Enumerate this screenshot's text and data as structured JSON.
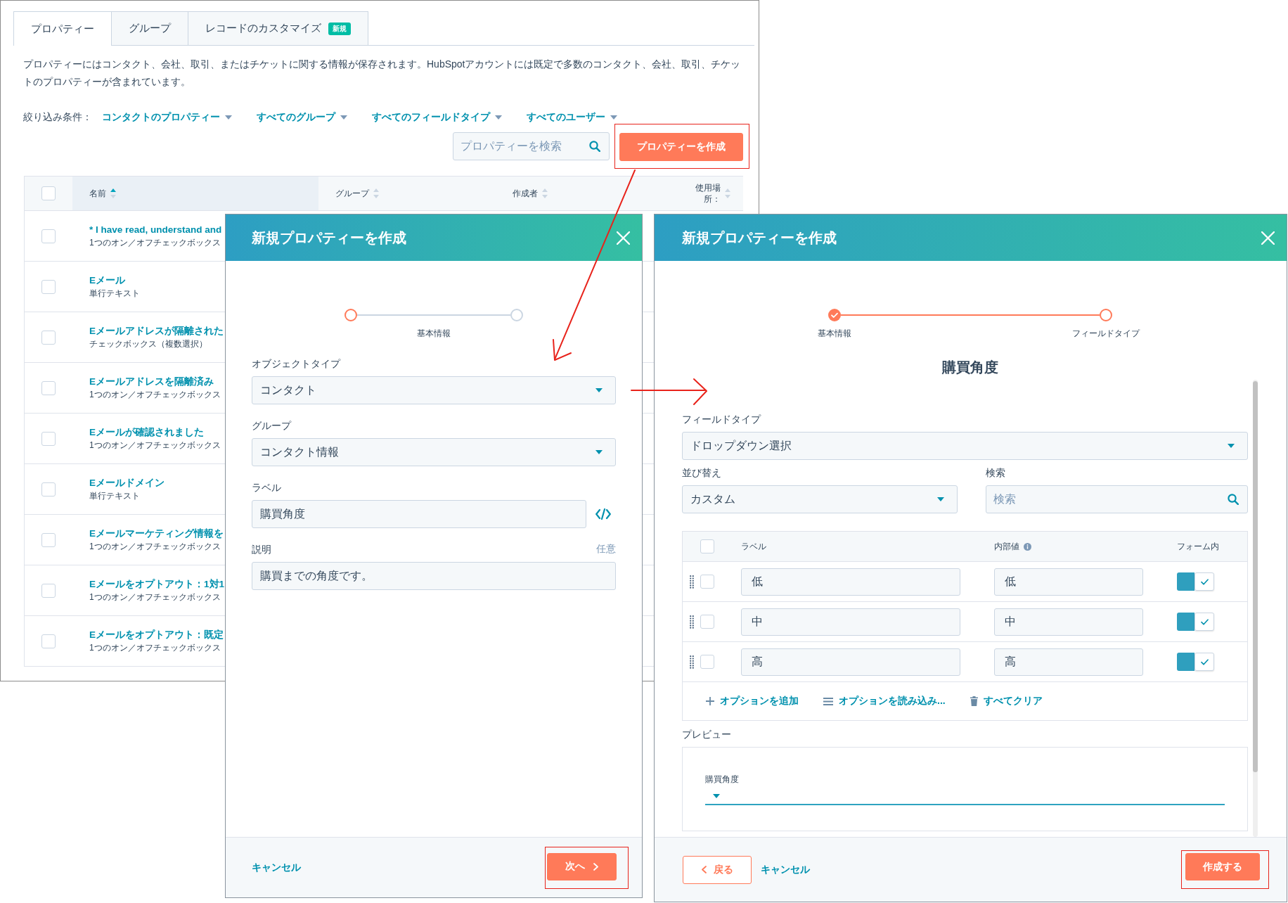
{
  "properties_page": {
    "tabs": [
      {
        "label": "プロパティー",
        "selected": true
      },
      {
        "label": "グループ",
        "selected": false
      },
      {
        "label": "レコードのカスタマイズ",
        "selected": false,
        "badge": "新規"
      }
    ],
    "description": "プロパティーにはコンタクト、会社、取引、またはチケットに関する情報が保存されます。HubSpotアカウントには既定で多数のコンタクト、会社、取引、チケットのプロパティーが含まれています。",
    "filters": {
      "label": "絞り込み条件：",
      "dropdowns": [
        "コンタクトのプロパティー",
        "すべてのグループ",
        "すべてのフィールドタイプ",
        "すべてのユーザー"
      ]
    },
    "search": {
      "placeholder": "プロパティーを検索"
    },
    "create_button": {
      "label": "プロパティーを作成",
      "highlighted": true
    },
    "table": {
      "select_all_checked": false,
      "columns": [
        {
          "label": "名前",
          "sorted": true
        },
        {
          "label": "グループ",
          "sorted": false
        },
        {
          "label": "作成者",
          "sorted": false
        },
        {
          "label": "使用場所：",
          "sorted": false
        }
      ],
      "rows": [
        {
          "name": "* I have read, understand and",
          "type": "1つのオン／オフチェックボックス",
          "checked": false
        },
        {
          "name": "Eメール",
          "type": "単行テキスト",
          "checked": false
        },
        {
          "name": "Eメールアドレスが隔離された",
          "type": "チェックボックス（複数選択）",
          "checked": false
        },
        {
          "name": "Eメールアドレスを隔離済み",
          "type": "1つのオン／オフチェックボックス",
          "checked": false
        },
        {
          "name": "Eメールが確認されました",
          "type": "1つのオン／オフチェックボックス",
          "checked": false
        },
        {
          "name": "Eメールドメイン",
          "type": "単行テキスト",
          "checked": false
        },
        {
          "name": "Eメールマーケティング情報を",
          "type": "1つのオン／オフチェックボックス",
          "checked": false
        },
        {
          "name": "Eメールをオプトアウト：1対1",
          "type": "1つのオン／オフチェックボックス",
          "checked": false
        },
        {
          "name": "Eメールをオプトアウト：既定",
          "type": "1つのオン／オフチェックボックス",
          "checked": false
        }
      ]
    }
  },
  "create_dialog_basic": {
    "title": "新規プロパティーを作成",
    "stepper": {
      "caption": "基本情報",
      "steps": [
        {
          "completed": false,
          "active": true
        },
        {
          "completed": false,
          "active": false
        }
      ]
    },
    "fields": [
      {
        "kind": "select",
        "label": "オブジェクトタイプ",
        "value": "コンタクト"
      },
      {
        "kind": "select",
        "label": "グループ",
        "value": "コンタクト情報"
      },
      {
        "kind": "token_text",
        "label": "ラベル",
        "value": "購買角度"
      },
      {
        "kind": "text",
        "label": "説明",
        "note": "任意",
        "value": "購買までの角度です。"
      }
    ],
    "footer": {
      "cancel": "キャンセル",
      "next_button": {
        "label": "次へ",
        "highlighted": true
      }
    }
  },
  "create_dialog_field_type": {
    "title": "新規プロパティーを作成",
    "stepper": {
      "steps": [
        {
          "label": "基本情報",
          "completed": true,
          "active": false
        },
        {
          "label": "フィールドタイプ",
          "completed": false,
          "active": true
        }
      ]
    },
    "heading": "購買角度",
    "field_type": {
      "label": "フィールドタイプ",
      "value": "ドロップダウン選択"
    },
    "sort": {
      "label": "並び替え",
      "value": "カスタム"
    },
    "search": {
      "label": "検索",
      "placeholder": "検索"
    },
    "options": {
      "select_all_checked": false,
      "columns": [
        "ラベル",
        "内部値",
        "フォーム内"
      ],
      "rows": [
        {
          "label": "低",
          "value": "低",
          "checked": false,
          "in_form": true
        },
        {
          "label": "中",
          "value": "中",
          "checked": false,
          "in_form": true
        },
        {
          "label": "高",
          "value": "高",
          "checked": false,
          "in_form": true
        }
      ],
      "actions": [
        {
          "kind": "add",
          "label": "オプションを追加"
        },
        {
          "kind": "import",
          "label": "オプションを読み込み..."
        },
        {
          "kind": "clear",
          "label": "すべてクリア"
        }
      ]
    },
    "preview": {
      "title": "プレビュー",
      "field_label": "購買角度"
    },
    "footer": {
      "back_button": "戻る",
      "cancel": "キャンセル",
      "create_button": {
        "label": "作成する",
        "highlighted": true
      }
    }
  }
}
